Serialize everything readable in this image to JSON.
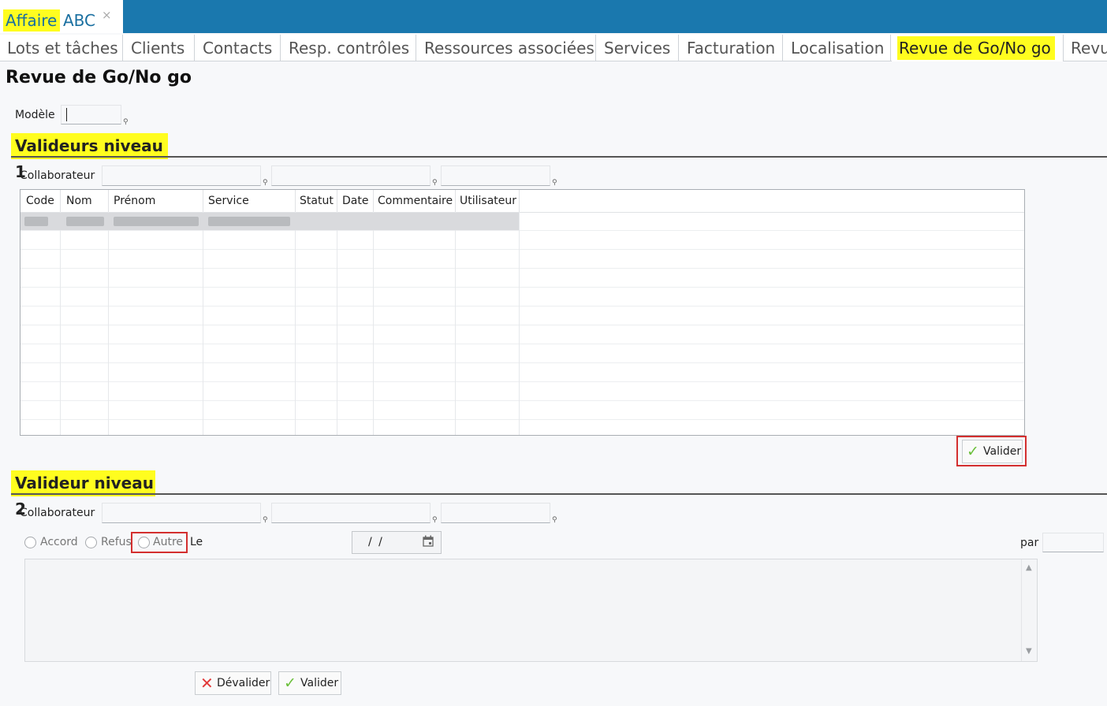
{
  "doc_tab": {
    "part1": "Affaire",
    "part2": "ABC",
    "close": "×"
  },
  "subtabs": [
    "Lots et tâches",
    "Clients",
    "Contacts",
    "Resp. contrôles",
    "Ressources associées",
    "Services",
    "Facturation",
    "Localisation",
    "Revue de Go/No go",
    "Revu"
  ],
  "page_title": "Revue de Go/No go",
  "modele_label": "Modèle",
  "section1": {
    "title": "Valideurs niveau 1",
    "collab_label": "Collaborateur",
    "columns": [
      "Code",
      "Nom",
      "Prénom",
      "Service",
      "Statut",
      "Date",
      "Commentaire",
      "Utilisateur"
    ],
    "valider_label": "Valider"
  },
  "section2": {
    "title": "Valideur niveau 2",
    "collab_label": "Collaborateur",
    "radios": [
      "Accord",
      "Refus",
      "Autre"
    ],
    "le_label": "Le",
    "date_value": "/  /",
    "par_label": "par",
    "devalider_label": "Dévalider",
    "valider_label": "Valider"
  },
  "icons": {
    "pin": "pin-icon",
    "check": "check-icon",
    "cross": "cross-icon",
    "calendar": "calendar-icon"
  },
  "colors": {
    "brand": "#1a78ae",
    "highlight": "#fffd1f",
    "error": "#d32f2f",
    "check": "#6abf3a"
  }
}
